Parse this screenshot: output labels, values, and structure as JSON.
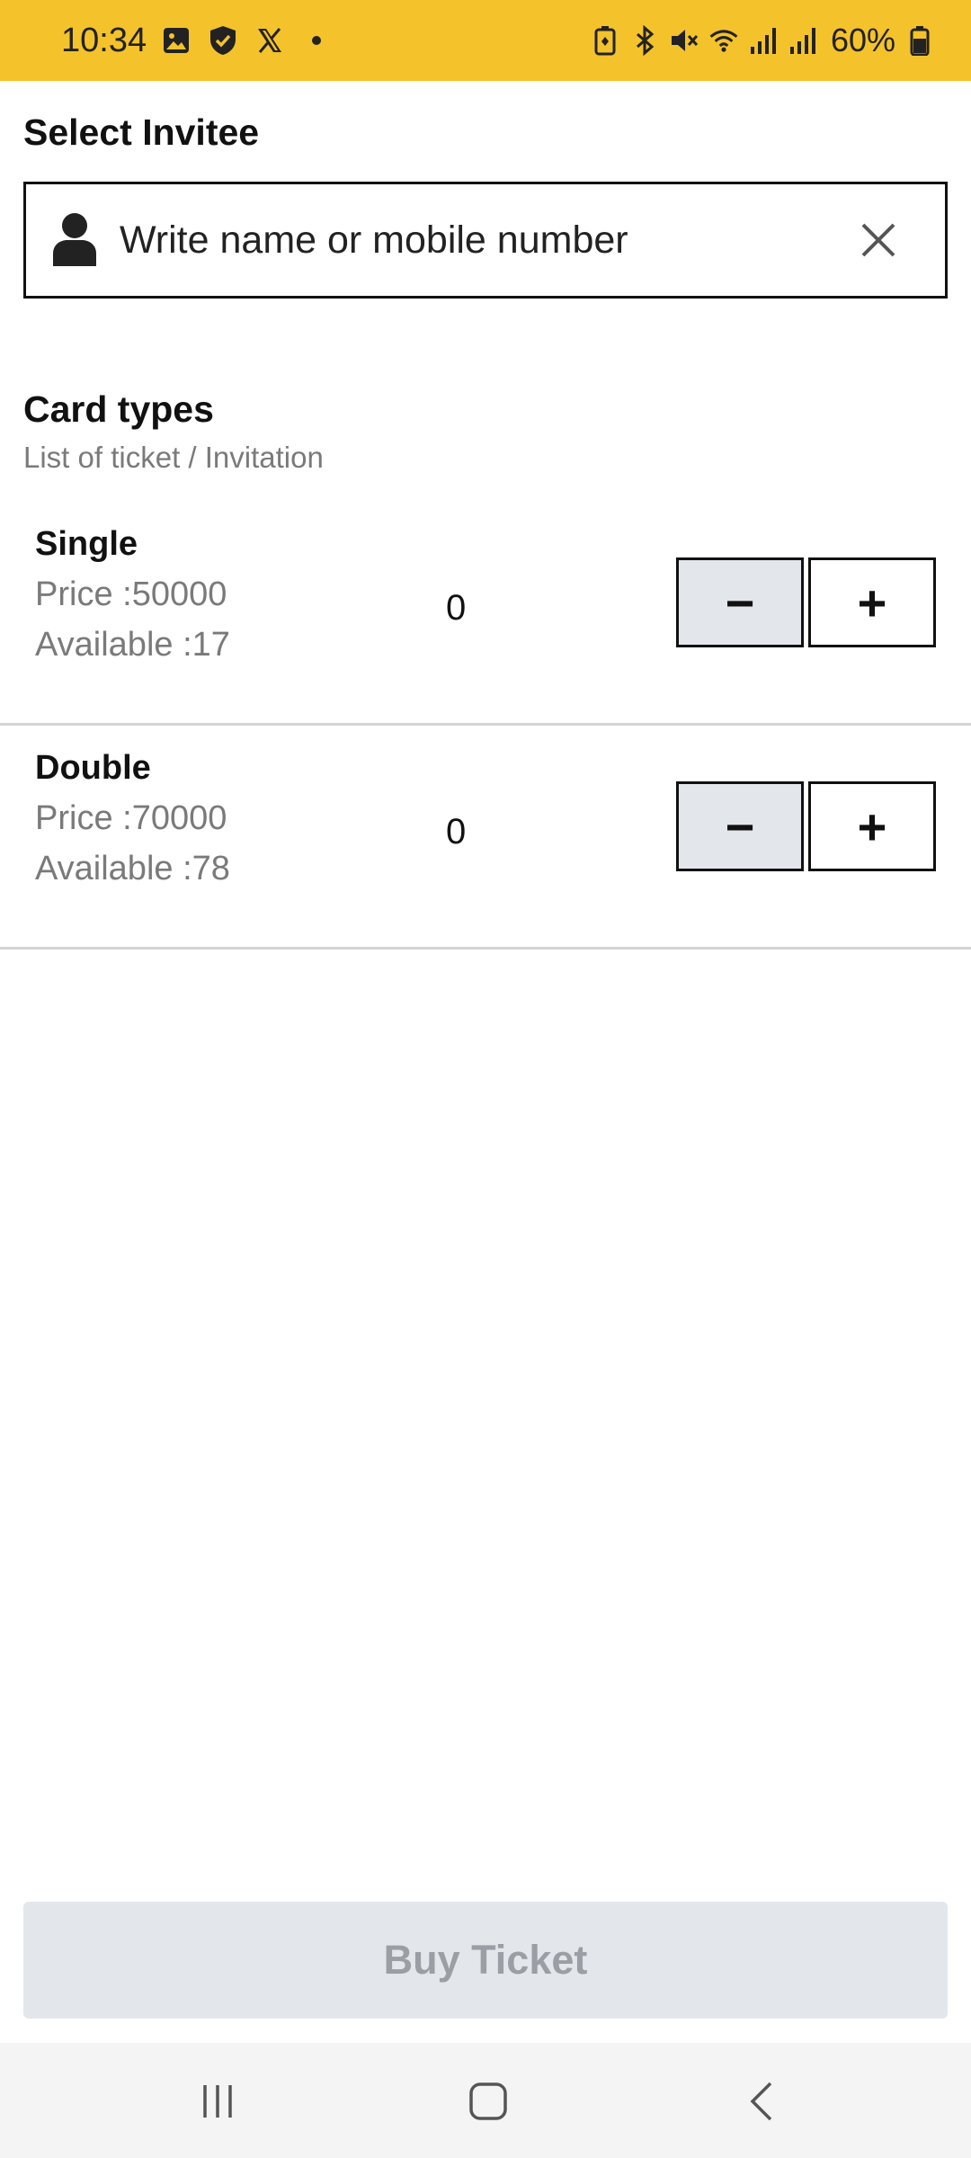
{
  "status_bar": {
    "time": "10:34",
    "battery": "60%",
    "left_icons": [
      "gallery-icon",
      "shield-check-icon",
      "x-logo-icon",
      "dot-icon"
    ],
    "right_icons": [
      "battery-saver-icon",
      "bluetooth-icon",
      "mute-icon",
      "wifi-icon",
      "signal-icon",
      "signal-icon",
      "battery-icon"
    ],
    "background": "#f4c22b"
  },
  "invitee": {
    "title": "Select Invitee",
    "placeholder": "Write name or mobile number"
  },
  "card_types": {
    "title": "Card types",
    "subtitle": "List of ticket / Invitation",
    "items": [
      {
        "name": "Single",
        "price": "Price :50000",
        "available": "Available :17",
        "quantity": "0",
        "minus": "−",
        "plus": "+"
      },
      {
        "name": "Double",
        "price": "Price :70000",
        "available": "Available :78",
        "quantity": "0",
        "minus": "−",
        "plus": "+"
      }
    ]
  },
  "buy_button": {
    "label": "Buy Ticket",
    "state": "disabled"
  },
  "nav_bar": {
    "items": [
      "recent-apps-icon",
      "home-icon",
      "back-icon"
    ]
  }
}
